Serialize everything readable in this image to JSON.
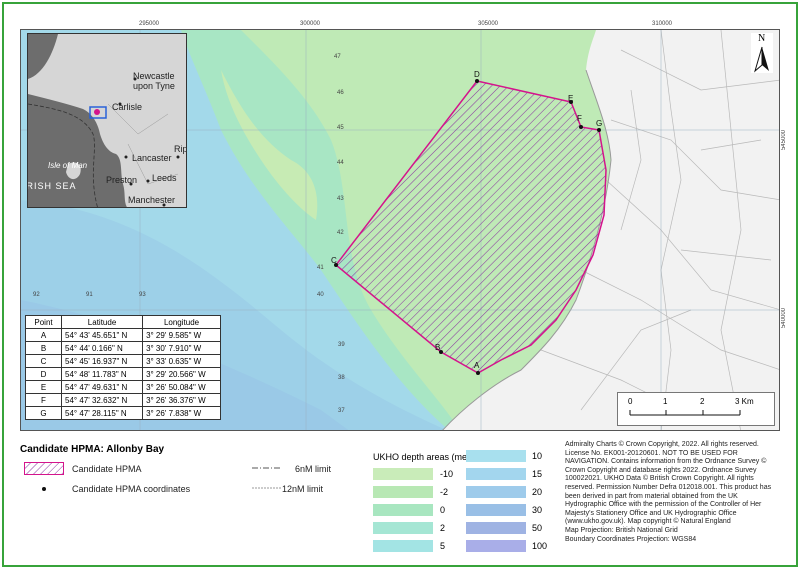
{
  "map": {
    "grid_top_labels": [
      "295000",
      "300000",
      "305000",
      "310000"
    ],
    "grid_right_labels": [
      "545000",
      "540000"
    ],
    "depth_soundings": [
      "47",
      "46",
      "45",
      "44",
      "43",
      "42",
      "41",
      "40",
      "39",
      "38",
      "37",
      "92",
      "91",
      "93"
    ],
    "points": [
      "A",
      "B",
      "C",
      "D",
      "E",
      "F",
      "G"
    ]
  },
  "inset": {
    "places": [
      "Newcastle upon Tyne",
      "Carlisle",
      "Isle of Man",
      "Lancaster",
      "Rip",
      "Preston",
      "Leeds",
      "Manchester",
      "IRISH SEA"
    ]
  },
  "coords_table": {
    "headers": [
      "Point",
      "Latitude",
      "Longitude"
    ],
    "rows": [
      [
        "A",
        "54° 43' 45.651\" N",
        "3° 29' 9.585\" W"
      ],
      [
        "B",
        "54° 44' 0.166\" N",
        "3° 30' 7.910\" W"
      ],
      [
        "C",
        "54° 45' 16.937\" N",
        "3° 33' 0.635\" W"
      ],
      [
        "D",
        "54° 48' 11.783\" N",
        "3° 29' 20.566\" W"
      ],
      [
        "E",
        "54° 47' 49.631\" N",
        "3° 26' 50.084\" W"
      ],
      [
        "F",
        "54° 47' 32.632\" N",
        "3° 26' 36.376\" W"
      ],
      [
        "G",
        "54° 47' 28.115\" N",
        "3° 26' 7.838\" W"
      ]
    ]
  },
  "north_arrow": "N",
  "scale_bar": {
    "labels": [
      "0",
      "1",
      "2",
      "3 Km"
    ]
  },
  "legend": {
    "title": "Candidate HPMA: Allonby Bay",
    "hpma": "Candidate HPMA",
    "coordinates": "Candidate HPMA coordinates",
    "limit_6nm": "6nM limit",
    "limit_12nm": "12nM limit",
    "depth_title": "UKHO depth areas (metres)",
    "depth_left": [
      {
        "label": "-10",
        "color": "#c9ecb9"
      },
      {
        "label": "-2",
        "color": "#b8e8b4"
      },
      {
        "label": "0",
        "color": "#a8e6c0"
      },
      {
        "label": "2",
        "color": "#a5e6d4"
      },
      {
        "label": "5",
        "color": "#a3e4e4"
      }
    ],
    "depth_right": [
      {
        "label": "10",
        "color": "#a8e0ee"
      },
      {
        "label": "15",
        "color": "#a3d6ee"
      },
      {
        "label": "20",
        "color": "#9ecbeb"
      },
      {
        "label": "30",
        "color": "#99bfe6"
      },
      {
        "label": "50",
        "color": "#9fb3e3"
      },
      {
        "label": "100",
        "color": "#a9aee8"
      }
    ]
  },
  "copyright": [
    "Admiralty Charts © Crown Copyright, 2022. All rights reserved. License No. EK001-20120601. NOT TO BE USED FOR NAVIGATION. Contains information from the Ordnance Survey © Crown Copyright and database rights 2022. Ordnance Survey 100022021. UKHO Data © British Crown Copyright. All rights reserved. Permission Number Defra 012018.001. This product has been derived in part from material obtained from the UK Hydrographic Office with the permission of the Controller of Her Majesty's Stationery Office and UK Hydrographic Office (www.ukho.gov.uk). Map copyright © Natural England",
    "Map Projection: British National Grid",
    "Boundary Coordinates Projection: WGS84"
  ],
  "colors": {
    "frame": "#37a33a",
    "hpma_outline": "#d4148c",
    "hatch": "#8a3aa0"
  }
}
